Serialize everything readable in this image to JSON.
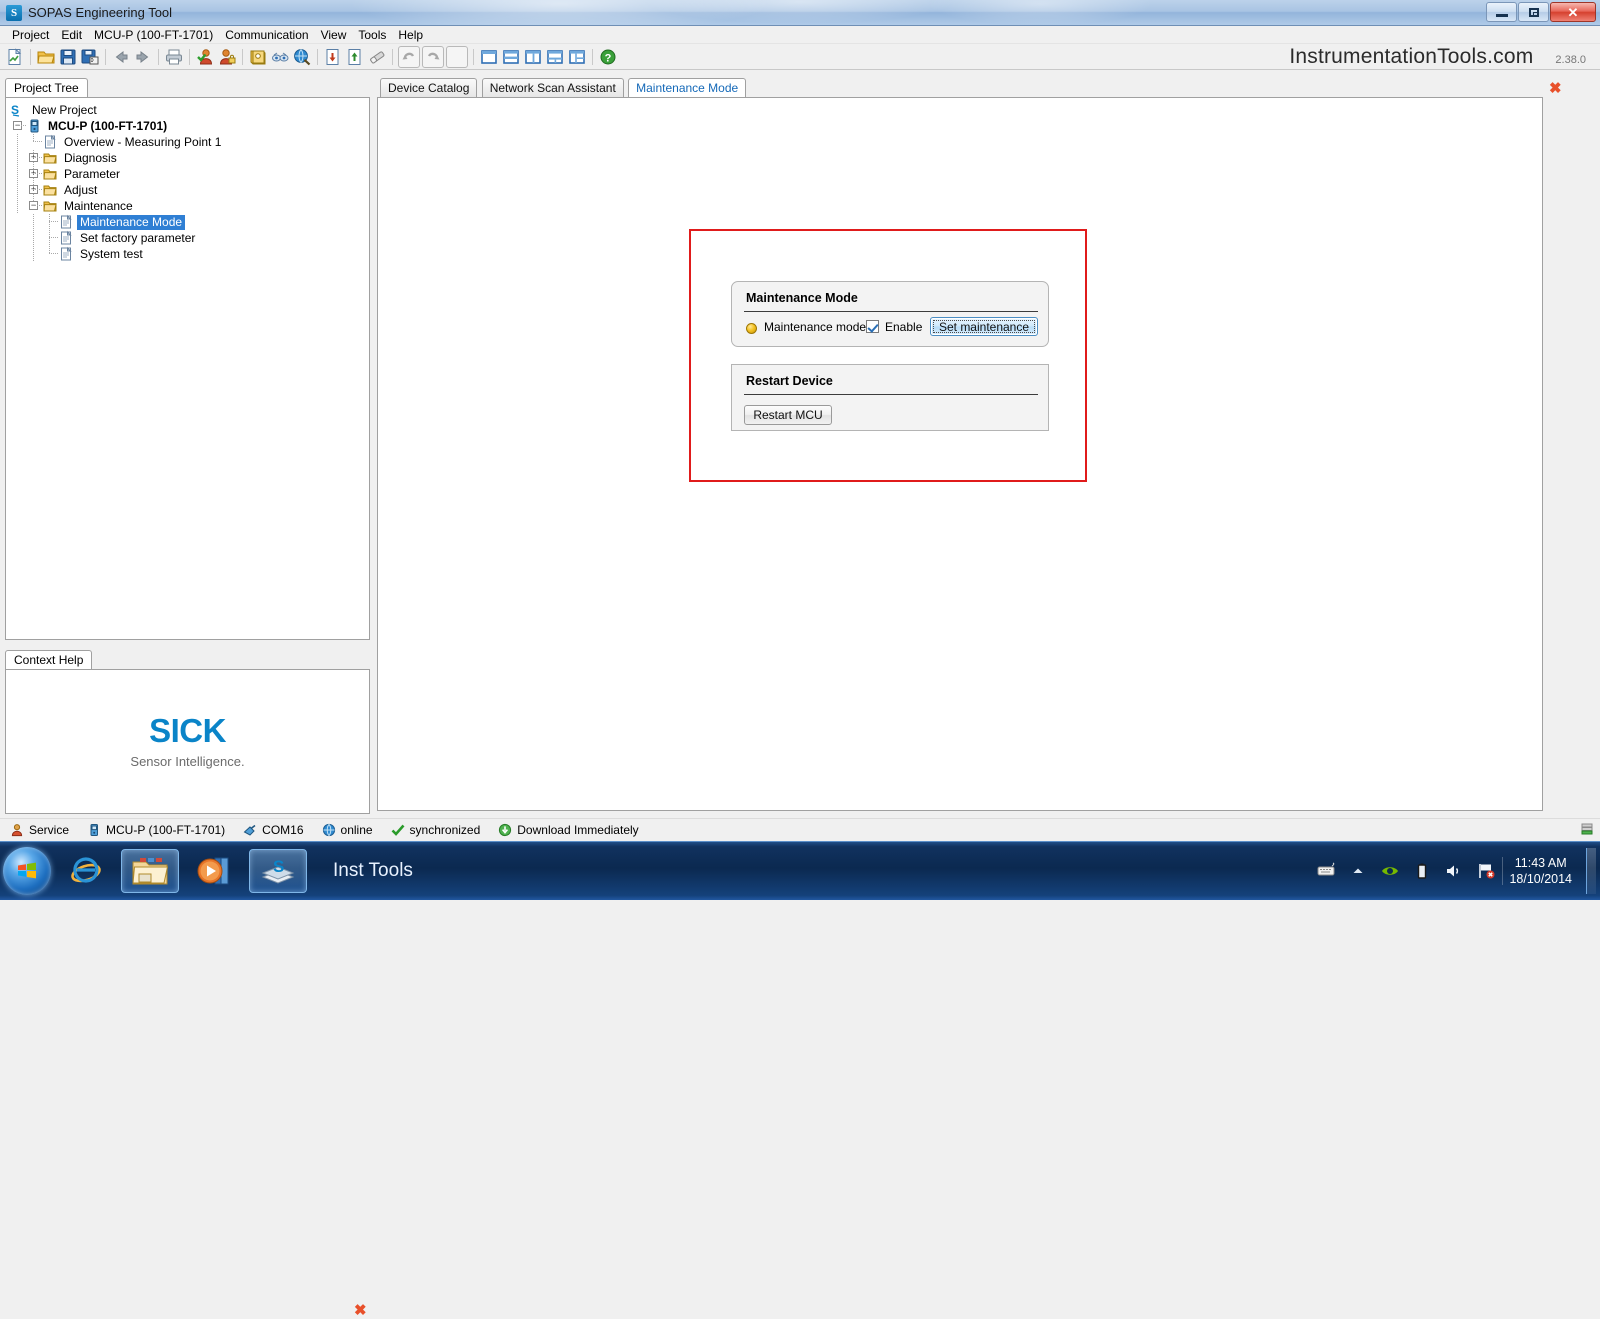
{
  "window": {
    "title": "SOPAS Engineering Tool",
    "app_icon": "sopas-icon",
    "controls": {
      "minimize": "Minimize",
      "restore": "Restore",
      "close": "Close"
    }
  },
  "menubar": {
    "items": [
      {
        "label": "Project"
      },
      {
        "label": "Edit"
      },
      {
        "label": "MCU-P (100-FT-1701)"
      },
      {
        "label": "Communication"
      },
      {
        "label": "View"
      },
      {
        "label": "Tools"
      },
      {
        "label": "Help"
      }
    ]
  },
  "toolbar": {
    "buttons": [
      {
        "name": "new-document-icon"
      },
      {
        "name": "open-folder-icon"
      },
      {
        "name": "save-icon"
      },
      {
        "name": "save-all-icon"
      },
      {
        "name": "back-arrow-icon"
      },
      {
        "name": "forward-arrow-icon"
      },
      {
        "name": "print-icon"
      },
      {
        "name": "add-user-icon"
      },
      {
        "name": "user-settings-icon"
      },
      {
        "name": "address-book-icon"
      },
      {
        "name": "network-scan-icon"
      },
      {
        "name": "globe-search-icon"
      },
      {
        "name": "download-icon"
      },
      {
        "name": "upload-icon"
      },
      {
        "name": "eraser-icon"
      },
      {
        "name": "undo-icon"
      },
      {
        "name": "redo-icon"
      },
      {
        "name": "layout-single-icon"
      },
      {
        "name": "layout-horizontal-icon"
      },
      {
        "name": "layout-vertical-icon"
      },
      {
        "name": "layout-three-icon"
      },
      {
        "name": "layout-grid-icon"
      },
      {
        "name": "help-icon"
      }
    ],
    "brand": "InstrumentationTools.com",
    "version": "2.38.0"
  },
  "left": {
    "project_tree_tab": "Project Tree",
    "tree": [
      {
        "label": "New Project",
        "indent": 0,
        "icon": "sopas-project-icon",
        "expander": "",
        "bold": false,
        "selected": false
      },
      {
        "label": "MCU-P (100-FT-1701)",
        "indent": 1,
        "icon": "device-icon",
        "expander": "-",
        "bold": true,
        "selected": false
      },
      {
        "label": "Overview - Measuring Point 1",
        "indent": 2,
        "icon": "page-icon",
        "expander": "",
        "bold": false,
        "selected": false
      },
      {
        "label": "Diagnosis",
        "indent": 2,
        "icon": "folder-icon",
        "expander": "+",
        "bold": false,
        "selected": false
      },
      {
        "label": "Parameter",
        "indent": 2,
        "icon": "folder-icon",
        "expander": "+",
        "bold": false,
        "selected": false
      },
      {
        "label": "Adjust",
        "indent": 2,
        "icon": "folder-icon",
        "expander": "+",
        "bold": false,
        "selected": false
      },
      {
        "label": "Maintenance",
        "indent": 2,
        "icon": "folder-icon",
        "expander": "-",
        "bold": false,
        "selected": false
      },
      {
        "label": "Maintenance Mode",
        "indent": 3,
        "icon": "page-icon",
        "expander": "",
        "bold": false,
        "selected": true
      },
      {
        "label": "Set factory parameter",
        "indent": 3,
        "icon": "page-icon",
        "expander": "",
        "bold": false,
        "selected": false
      },
      {
        "label": "System test",
        "indent": 3,
        "icon": "page-icon",
        "expander": "",
        "bold": false,
        "selected": false
      }
    ],
    "context_help_tab": "Context Help",
    "logo": {
      "wordmark": "SICK",
      "tagline": "Sensor Intelligence.",
      "color": "#0a84c8"
    },
    "close_icon": "close-icon"
  },
  "main": {
    "tabs": [
      {
        "label": "Device Catalog",
        "active": false
      },
      {
        "label": "Network Scan Assistant",
        "active": false
      },
      {
        "label": "Maintenance Mode",
        "active": true
      }
    ],
    "close_icon": "close-icon",
    "highlight_color": "#e01b1b",
    "maintenance_group": {
      "title": "Maintenance Mode",
      "led_label": "Maintenance mode",
      "led_color": "#f5c425",
      "checkbox_label": "Enable",
      "checkbox_checked": true,
      "button_label": "Set maintenance"
    },
    "restart_group": {
      "title": "Restart Device",
      "button_label": "Restart MCU"
    }
  },
  "statusbar": {
    "items": [
      {
        "label": "Service",
        "icon": "user-icon"
      },
      {
        "label": "MCU-P (100-FT-1701)",
        "icon": "device-icon"
      },
      {
        "label": "COM16",
        "icon": "serial-port-icon"
      },
      {
        "label": "online",
        "icon": "globe-icon"
      },
      {
        "label": "synchronized",
        "icon": "check-icon"
      },
      {
        "label": "Download Immediately",
        "icon": "download-globe-icon"
      }
    ],
    "right_icon": "server-icon"
  },
  "taskbar": {
    "start_label": "Start",
    "apps": [
      {
        "name": "internet-explorer-icon",
        "active": false
      },
      {
        "name": "file-explorer-icon",
        "active": true
      },
      {
        "name": "media-player-icon",
        "active": false
      },
      {
        "name": "sopas-icon",
        "active": true
      }
    ],
    "window_title": "Inst Tools",
    "tray": [
      {
        "name": "keyboard-icon"
      },
      {
        "name": "show-hidden-icons-icon"
      },
      {
        "name": "nvidia-icon"
      },
      {
        "name": "battery-icon"
      },
      {
        "name": "volume-icon"
      },
      {
        "name": "network-flag-icon"
      }
    ],
    "time": "11:43 AM",
    "date": "18/10/2014"
  }
}
